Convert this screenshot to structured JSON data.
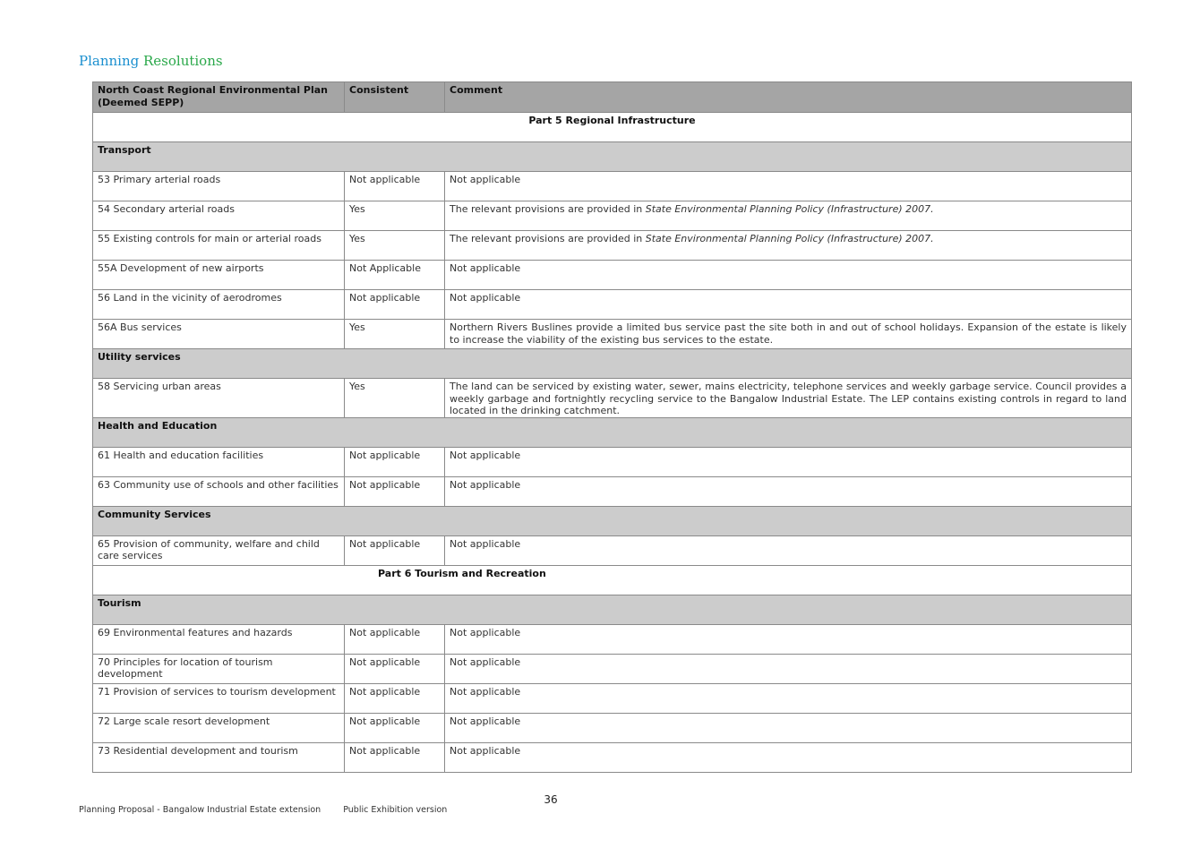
{
  "header": {
    "brand_word1": "Planning",
    "brand_word2": "Resolutions"
  },
  "table": {
    "headers": [
      "North Coast Regional Environmental Plan (Deemed SEPP)",
      "Consistent",
      "Comment"
    ],
    "sections": [
      {
        "type": "part",
        "title": "Part 5 Regional Infrastructure"
      },
      {
        "type": "cat",
        "title": "Transport"
      },
      {
        "type": "row",
        "provision": "53 Primary arterial roads",
        "consistent": "Not applicable",
        "comment": "Not applicable"
      },
      {
        "type": "row",
        "provision": "54 Secondary arterial roads",
        "consistent": "Yes",
        "comment": "The relevant provisions are provided in ",
        "comment_italic": "State Environmental Planning Policy (Infrastructure) 2007."
      },
      {
        "type": "row",
        "provision": "55 Existing controls for main or arterial roads",
        "consistent": "Yes",
        "comment": "The relevant provisions are provided in ",
        "comment_italic": "State Environmental Planning Policy (Infrastructure) 2007."
      },
      {
        "type": "row",
        "provision": "55A Development of new airports",
        "consistent": "Not Applicable",
        "comment": "Not applicable"
      },
      {
        "type": "row",
        "provision": "56 Land in the vicinity of aerodromes",
        "consistent": "Not applicable",
        "comment": "Not applicable"
      },
      {
        "type": "row",
        "provision": "56A Bus services",
        "consistent": "Yes",
        "comment": "Northern Rivers Buslines provide a limited bus service past the site both in and out of school holidays.  Expansion of the estate is likely to increase the viability of the existing bus services to the estate."
      },
      {
        "type": "cat",
        "title": "Utility services"
      },
      {
        "type": "row",
        "provision": "58 Servicing urban areas",
        "consistent": "Yes",
        "comment": "The land can be serviced by existing water, sewer, mains electricity, telephone services and weekly garbage service.  Council provides a weekly garbage and fortnightly recycling service to the Bangalow Industrial Estate.  The LEP contains existing controls in regard to land located in the drinking catchment."
      },
      {
        "type": "cat",
        "title": "Health and Education"
      },
      {
        "type": "row",
        "provision": "61 Health and education facilities",
        "consistent": "Not applicable",
        "comment": "Not applicable"
      },
      {
        "type": "row",
        "provision": "63 Community use of schools and other facilities",
        "consistent": "Not applicable",
        "comment": "Not applicable"
      },
      {
        "type": "cat",
        "title": "Community Services"
      },
      {
        "type": "row",
        "provision": "65 Provision of community, welfare and child care services",
        "consistent": "Not applicable",
        "comment": "Not applicable"
      },
      {
        "type": "part6",
        "title": "Part 6 Tourism and Recreation"
      },
      {
        "type": "cat",
        "title": "Tourism"
      },
      {
        "type": "row",
        "provision": "69 Environmental features and hazards",
        "consistent": "Not applicable",
        "comment": "Not applicable"
      },
      {
        "type": "row",
        "provision": "70 Principles for location of tourism development",
        "consistent": "Not applicable",
        "comment": "Not applicable"
      },
      {
        "type": "row",
        "provision": "71 Provision of services to tourism development",
        "consistent": "Not applicable",
        "comment": "Not applicable"
      },
      {
        "type": "row",
        "provision": "72 Large scale resort development",
        "consistent": "Not applicable",
        "comment": "Not applicable"
      },
      {
        "type": "row",
        "provision": "73 Residential development and tourism",
        "consistent": "Not applicable",
        "comment": "Not applicable"
      }
    ]
  },
  "footer": {
    "page_number": "36",
    "doc_title": "Planning Proposal - Bangalow Industrial Estate extension",
    "version": "Public Exhibition version"
  }
}
